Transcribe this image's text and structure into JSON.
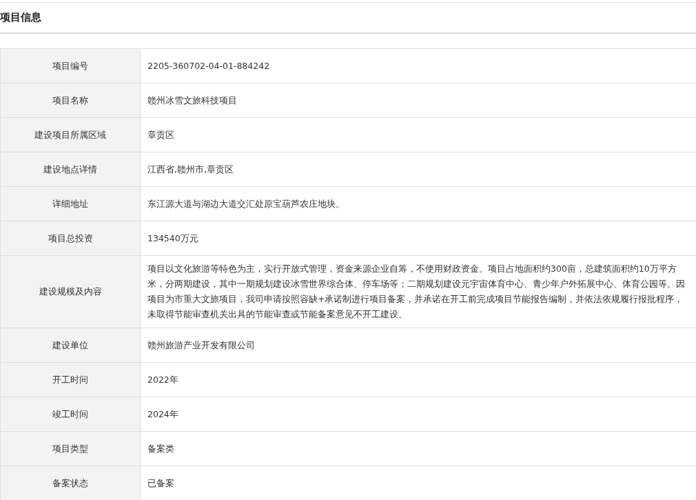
{
  "section": {
    "title": "项目信息"
  },
  "rows": [
    {
      "label": "项目编号",
      "value": "2205-360702-04-01-884242"
    },
    {
      "label": "项目名称",
      "value": "赣州冰雪文旅科技项目"
    },
    {
      "label": "建设项目所属区域",
      "value": "章贡区"
    },
    {
      "label": "建设地点详情",
      "value": "江西省,赣州市,章贡区"
    },
    {
      "label": "详细地址",
      "value": "东江源大道与湖边大道交汇处原宝葫芦农庄地块。"
    },
    {
      "label": "项目总投资",
      "value": "134540万元"
    },
    {
      "label": "建设规模及内容",
      "value": "项目以文化旅游等特色为主，实行开放式管理，资金来源企业自筹，不使用财政资金。项目占地面积约300亩，总建筑面积约10万平方米，分两期建设，其中一期规划建设冰雪世界综合体、停车场等；二期规划建设元宇宙体育中心、青少年户外拓展中心、体育公园等。因项目为市重大文旅项目，我司申请按照容缺+承诺制进行项目备案，并承诺在开工前完成项目节能报告编制，并依法依规履行报批程序，未取得节能审查机关出具的节能审查或节能备案意见不开工建设。"
    },
    {
      "label": "建设单位",
      "value": "赣州旅游产业开发有限公司"
    },
    {
      "label": "开工时间",
      "value": "2022年"
    },
    {
      "label": "竣工时间",
      "value": "2024年"
    },
    {
      "label": "项目类型",
      "value": "备案类"
    },
    {
      "label": "备案状态",
      "value": "已备案"
    }
  ]
}
